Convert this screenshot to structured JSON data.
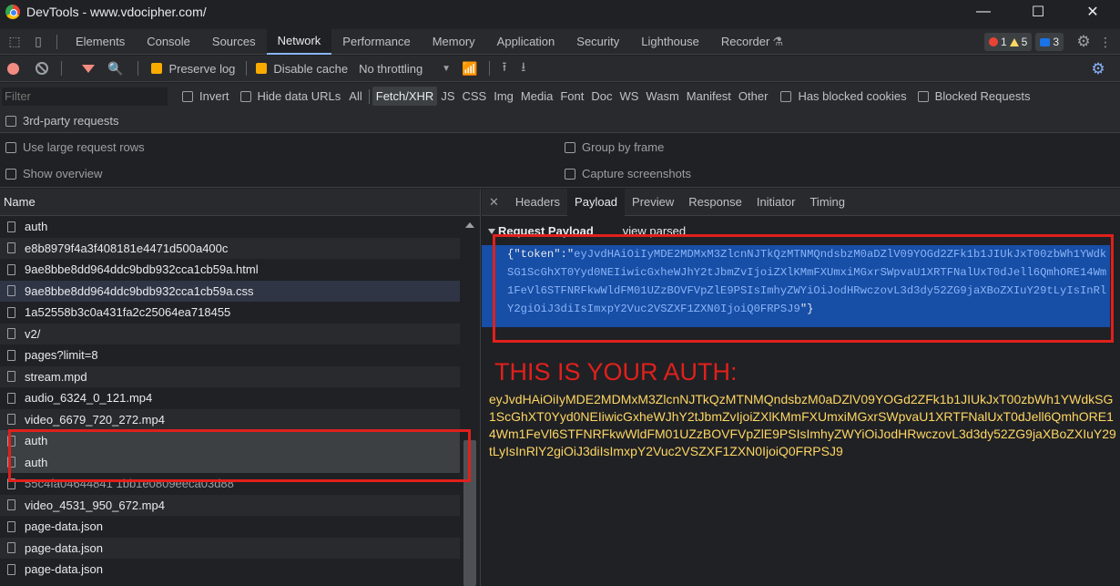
{
  "window": {
    "title": "DevTools - www.vdocipher.com/"
  },
  "panel_tabs": [
    "Elements",
    "Console",
    "Sources",
    "Network",
    "Performance",
    "Memory",
    "Application",
    "Security",
    "Lighthouse",
    "Recorder"
  ],
  "counters": {
    "errors": "1",
    "warnings": "5",
    "messages": "3"
  },
  "toolbar": {
    "preserve_log": "Preserve log",
    "disable_cache": "Disable cache",
    "throttling": "No throttling"
  },
  "filter": {
    "placeholder": "Filter",
    "invert": "Invert",
    "hide_data_urls": "Hide data URLs",
    "types": [
      "All",
      "Fetch/XHR",
      "JS",
      "CSS",
      "Img",
      "Media",
      "Font",
      "Doc",
      "WS",
      "Wasm",
      "Manifest",
      "Other"
    ],
    "has_blocked_cookies": "Has blocked cookies",
    "blocked_requests": "Blocked Requests",
    "third_party": "3rd-party requests"
  },
  "settings": {
    "large_rows": "Use large request rows",
    "overview": "Show overview",
    "group_by_frame": "Group by frame",
    "capture_screenshots": "Capture screenshots"
  },
  "request_list": {
    "header": "Name",
    "rows": [
      "auth",
      "e8b8979f4a3f408181e4471d500a400c",
      "9ae8bbe8dd964ddc9bdb932cca1cb59a.html",
      "9ae8bbe8dd964ddc9bdb932cca1cb59a.css",
      "1a52558b3c0a431fa2c25064ea718455",
      "v2/",
      "pages?limit=8",
      "stream.mpd",
      "audio_6324_0_121.mp4",
      "video_6679_720_272.mp4",
      "auth",
      "auth",
      "55c4fa04644841 1bb1e0809eeca03d88",
      "video_4531_950_672.mp4",
      "page-data.json",
      "page-data.json",
      "page-data.json"
    ]
  },
  "detail": {
    "tabs": [
      "Headers",
      "Payload",
      "Preview",
      "Response",
      "Initiator",
      "Timing"
    ],
    "payload_title": "Request Payload",
    "view_parsed": "view parsed",
    "payload_open": "{\"token\":\"",
    "token": "eyJvdHAiOiIyMDE2MDMxM3ZlcnNJTkQzMTNMQndsbzM0aDZlV09YOGd2ZFk1b1JIUkJxT00zbWh1YWdkSG1ScGhXT0Yyd0NEIiwicGxheWJhY2tJbmZvIjoiZXlKMmFXUmxiMGxrSWpvaU1XRTFNalUxT0dJell6QmhORE14Wm1FeVl6STFNRFkwWldFM01UZzBOVFVpZlE9PSIsImhyZWYiOiJodHRwczovL3d3dy52ZG9jaXBoZXIuY29tLyIsInRlY2giOiJ3diIsImxpY2Vuc2VSZXF1ZXN0IjoiQ0FRPSJ9",
    "payload_close": "\"}",
    "auth_heading": "THIS IS YOUR AUTH:",
    "auth_value": "eyJvdHAiOiIyMDE2MDMxM3ZlcnNJTkQzMTNMQndsbzM0aDZlV09YOGd2ZFk1b1JIUkJxT00zbWh1YWdkSG1ScGhXT0Yyd0NEIiwicGxheWJhY2tJbmZvIjoiZXlKMmFXUmxiMGxrSWpvaU1XRTFNalUxT0dJell6QmhORE14Wm1FeVl6STFNRFkwWldFM01UZzBOVFVpZlE9PSIsImhyZWYiOiJodHRwczovL3d3dy52ZG9jaXBoZXIuY29tLyIsInRlY2giOiJ3diIsImxpY2Vuc2VSZXF1ZXN0IjoiQ0FRPSJ9"
  },
  "colors": {
    "annotation_red": "#e0201c",
    "auth_yellow": "#fdd663",
    "selection_blue": "#174ea6"
  }
}
